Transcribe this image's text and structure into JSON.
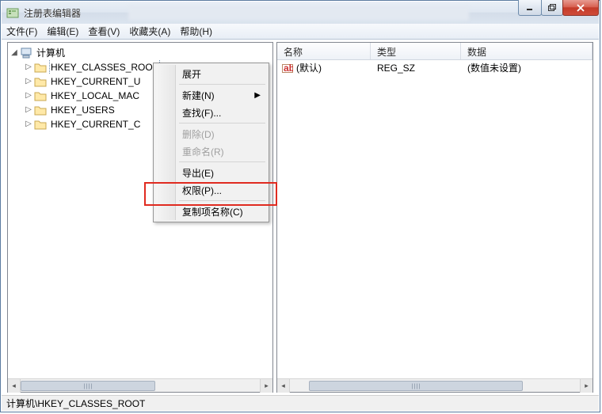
{
  "titlebar": {
    "title": "注册表编辑器"
  },
  "menu": {
    "file": "文件(F)",
    "edit": "编辑(E)",
    "view": "查看(V)",
    "favorites": "收藏夹(A)",
    "help": "帮助(H)"
  },
  "tree": {
    "root": "计算机",
    "keys": [
      "HKEY_CLASSES_ROOT",
      "HKEY_CURRENT_U",
      "HKEY_LOCAL_MAC",
      "HKEY_USERS",
      "HKEY_CURRENT_C"
    ],
    "selected_index": 0
  },
  "list": {
    "columns": {
      "name": "名称",
      "type": "类型",
      "data": "数据"
    },
    "rows": [
      {
        "name": "(默认)",
        "type": "REG_SZ",
        "data": "(数值未设置)"
      }
    ]
  },
  "context_menu": {
    "expand": "展开",
    "new": "新建(N)",
    "find": "查找(F)...",
    "delete": "删除(D)",
    "rename": "重命名(R)",
    "export": "导出(E)",
    "permissions": "权限(P)...",
    "copy_key_name": "复制项名称(C)"
  },
  "statusbar": {
    "path": "计算机\\HKEY_CLASSES_ROOT"
  }
}
